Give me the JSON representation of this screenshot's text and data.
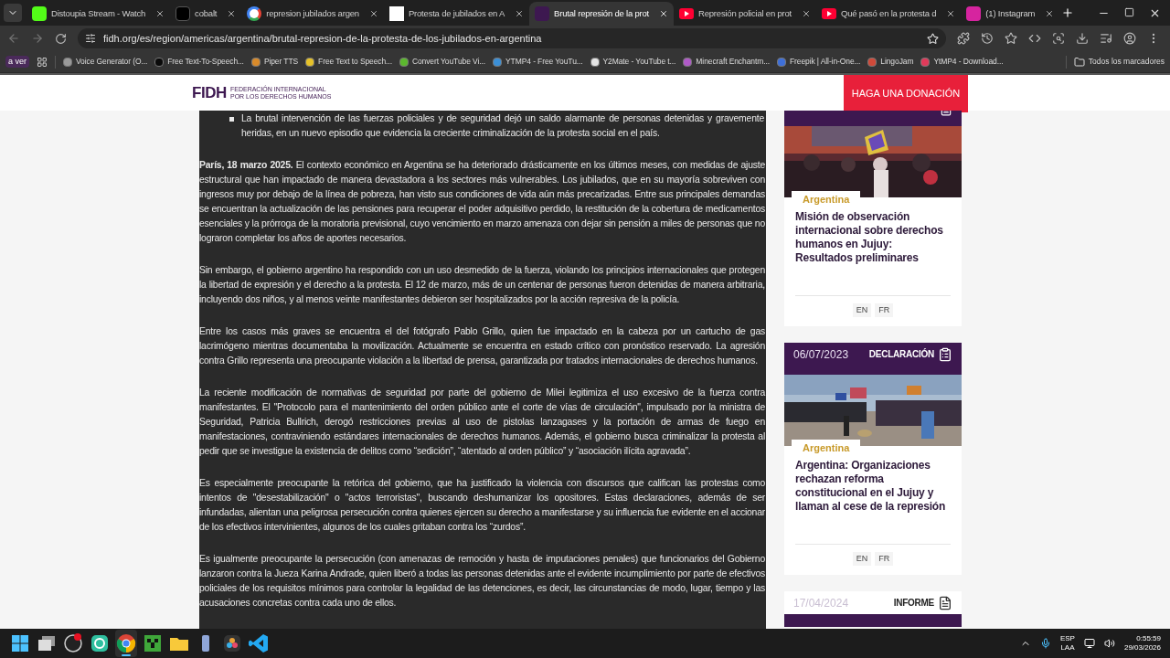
{
  "browser": {
    "tabs": [
      {
        "title": "Distoupia Stream - Watch",
        "kind": "k",
        "selected": false
      },
      {
        "title": "cobalt",
        "kind": "cobalt",
        "selected": false
      },
      {
        "title": "represion jubilados argen",
        "kind": "google",
        "selected": false
      },
      {
        "title": "Protesta de jubilados en A",
        "kind": "dots",
        "selected": false
      },
      {
        "title": "Brutal represión de la prot",
        "kind": "fidh",
        "selected": true
      },
      {
        "title": "Represión policial en prot",
        "kind": "youtube",
        "selected": false
      },
      {
        "title": "Qué pasó en la protesta d",
        "kind": "youtube",
        "selected": false
      },
      {
        "title": "(1) Instagram",
        "kind": "instagram",
        "selected": false
      }
    ],
    "url": "fidh.org/es/region/americas/argentina/brutal-represion-de-la-protesta-de-los-jubilados-en-argentina",
    "bookmark_group": "a ver",
    "bookmarks": [
      {
        "label": "Voice Generator (O...",
        "color": "#9a9a9a"
      },
      {
        "label": "Free Text-To-Speech...",
        "color": "#0a0a0a"
      },
      {
        "label": "Piper TTS",
        "color": "#d88a2a"
      },
      {
        "label": "Free Text to Speech...",
        "color": "#e6c229"
      },
      {
        "label": "Convert YouTube Vi...",
        "color": "#5cb82e"
      },
      {
        "label": "YTMP4 - Free YouTu...",
        "color": "#3b8fd6"
      },
      {
        "label": "Y2Mate - YouTube t...",
        "color": "#e5e5e5"
      },
      {
        "label": "Minecraft Enchantm...",
        "color": "#b05ac8"
      },
      {
        "label": "Freepik | All-in-One...",
        "color": "#3e6fd8"
      },
      {
        "label": "LingoJam",
        "color": "#d04a3a"
      },
      {
        "label": "YtMP4 - Download...",
        "color": "#e03a5a"
      }
    ],
    "all_bookmarks": "Todos los marcadores"
  },
  "site": {
    "logo": "FIDH",
    "logo_lines": [
      "FEDERACIÓN INTERNACIONAL",
      "POR LOS DERECHOS HUMANOS"
    ],
    "donate_button": "HAGA UNA DONACIÓN"
  },
  "article": {
    "bullets": [
      "La brutal intervención de las fuerzas policiales y de seguridad dejó un saldo alarmante de personas detenidas y gravemente heridas, en un nuevo episodio que evidencia la creciente criminalización de la protesta social en el país."
    ],
    "paragraphs": [
      "**París, 18 marzo 2025.** El contexto económico en Argentina se ha deteriorado drásticamente en los últimos meses, con medidas de ajuste estructural que han impactado de manera devastadora a los sectores más vulnerables. Los jubilados, que en su mayoría sobreviven con ingresos muy por debajo de la línea de pobreza, han visto sus condiciones de vida aún más precarizadas. Entre sus principales demandas se encuentran la actualización de las pensiones para recuperar el poder adquisitivo perdido, la restitución de la cobertura de medicamentos esenciales y la prórroga de la moratoria previsional, cuyo vencimiento en marzo amenaza con dejar sin pensión a miles de personas que no lograron completar los años de aportes necesarios.",
      "Sin embargo, el gobierno argentino ha respondido con un uso desmedido de la fuerza, violando los principios internacionales que protegen la libertad de expresión y el derecho a la protesta. El 12 de marzo, más de un centenar de personas fueron detenidas de manera arbitraria, incluyendo dos niños, y al menos veinte manifestantes debieron ser hospitalizados por la acción represiva de la policía.",
      "Entre los casos más graves se encuentra el del fotógrafo Pablo Grillo, quien fue impactado en la cabeza por un cartucho de gas lacrimógeno mientras documentaba la movilización. Actualmente se encuentra en estado crítico con pronóstico reservado. La agresión contra Grillo representa una preocupante violación a la libertad de prensa, garantizada por tratados internacionales de derechos humanos.",
      "La reciente modificación de normativas de seguridad por parte del gobierno de Milei legitimiza el uso excesivo de la fuerza contra manifestantes. El \"Protocolo para el mantenimiento del orden público ante el corte de vías de circulación\", impulsado por la ministra de Seguridad, Patricia Bullrich, derogó restricciones previas al uso de pistolas lanzagases y la portación de armas de fuego en manifestaciones, contraviniendo estándares internacionales de derechos humanos. Además, el gobierno busca criminalizar la protesta al pedir que se investigue la existencia de delitos como “sedición”, “atentado al orden público” y “asociación ilícita agravada”.",
      "Es especialmente preocupante la retórica del gobierno, que ha justificado la violencia con discursos que califican las protestas como intentos de \"desestabilización\" o \"actos terroristas\", buscando deshumanizar los opositores. Estas declaraciones, además de ser infundadas, alientan una peligrosa persecución contra quienes ejercen su derecho a manifestarse y su influencia fue evidente en el accionar de los efectivos intervinientes, algunos de los cuales gritaban contra los “zurdos”.",
      "Es igualmente preocupante la persecución (con amenazas de remoción y hasta de imputaciones penales) que funcionarios del Gobierno lanzaron contra la Jueza Karina Andrade, quien liberó a todas las personas detenidas ante el evidente incumplimiento por parte de efectivos policiales de los requisitos mínimos para controlar la legalidad de las detenciones, es decir, las circunstancias de modo, lugar, tiempo y las acusaciones concretas contra cada uno de ellos."
    ]
  },
  "sidebar": {
    "cards": [
      {
        "kind": "cut",
        "tag": "Argentina",
        "title": "Misión de observación internacional sobre derechos humanos en Jujuy: Resultados preliminares",
        "languages": [
          "EN",
          "FR"
        ]
      },
      {
        "kind": "full",
        "date": "06/07/2023",
        "type_label": "DECLARACIÓN",
        "tag": "Argentina",
        "title": "Argentina: Organizaciones rechazan reforma constitucional en el Jujuy y llaman al cese de la represión",
        "languages": [
          "EN",
          "FR"
        ]
      },
      {
        "kind": "top",
        "date": "17/04/2024",
        "type_label": "INFORME"
      }
    ]
  },
  "taskbar": {
    "apps": [
      {
        "kind": "start",
        "active": false
      },
      {
        "kind": "taskview",
        "active": false
      },
      {
        "kind": "obs",
        "active": false
      },
      {
        "kind": "green",
        "active": false
      },
      {
        "kind": "chrome",
        "active": true
      },
      {
        "kind": "minecraft",
        "active": false
      },
      {
        "kind": "folder",
        "active": false
      },
      {
        "kind": "tool",
        "active": false
      },
      {
        "kind": "resolve",
        "active": false
      },
      {
        "kind": "vscode",
        "active": false
      }
    ],
    "language": [
      "ESP",
      "LAA"
    ],
    "time": "0:55:59",
    "date": "29/03/2026"
  }
}
